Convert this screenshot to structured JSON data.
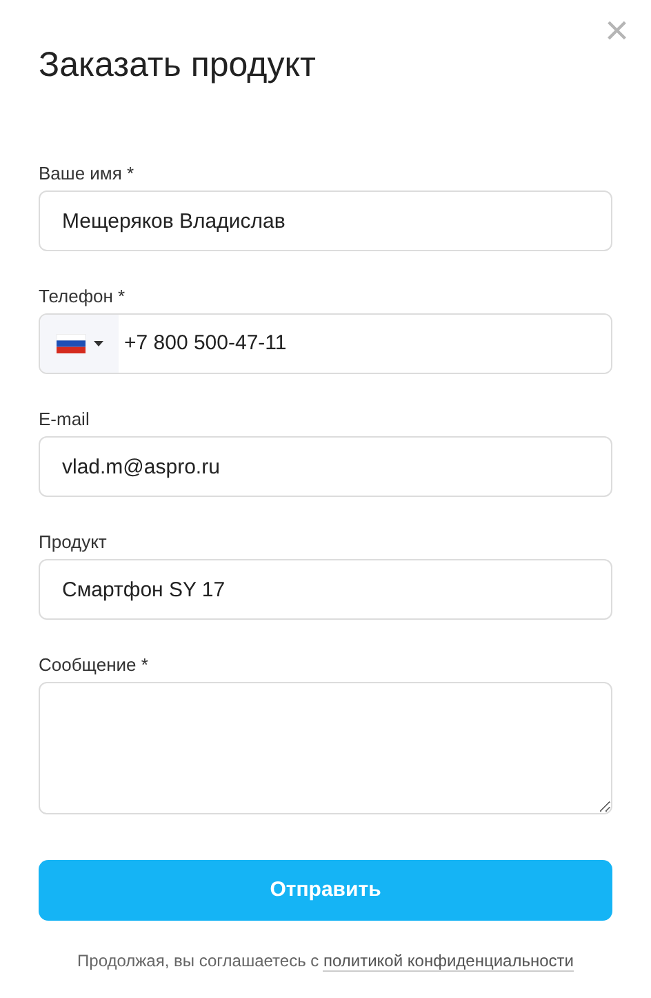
{
  "dialog": {
    "title": "Заказать продукт",
    "close": "×"
  },
  "fields": [
    {
      "kind": "text",
      "label": "Ваше имя *",
      "value": "Мещеряков Владислав"
    },
    {
      "kind": "phone",
      "label": "Телефон *",
      "value": "+7 800 500-47-11"
    },
    {
      "kind": "text",
      "label": "E-mail",
      "value": "vlad.m@aspro.ru"
    },
    {
      "kind": "text",
      "label": "Продукт",
      "value": "Смартфон SY 17"
    },
    {
      "kind": "textarea",
      "label": "Сообщение *"
    }
  ],
  "submit": "Отправить",
  "consent": {
    "text": "Продолжая, вы соглашаетесь с",
    "link": "политикой конфиденциальности"
  }
}
